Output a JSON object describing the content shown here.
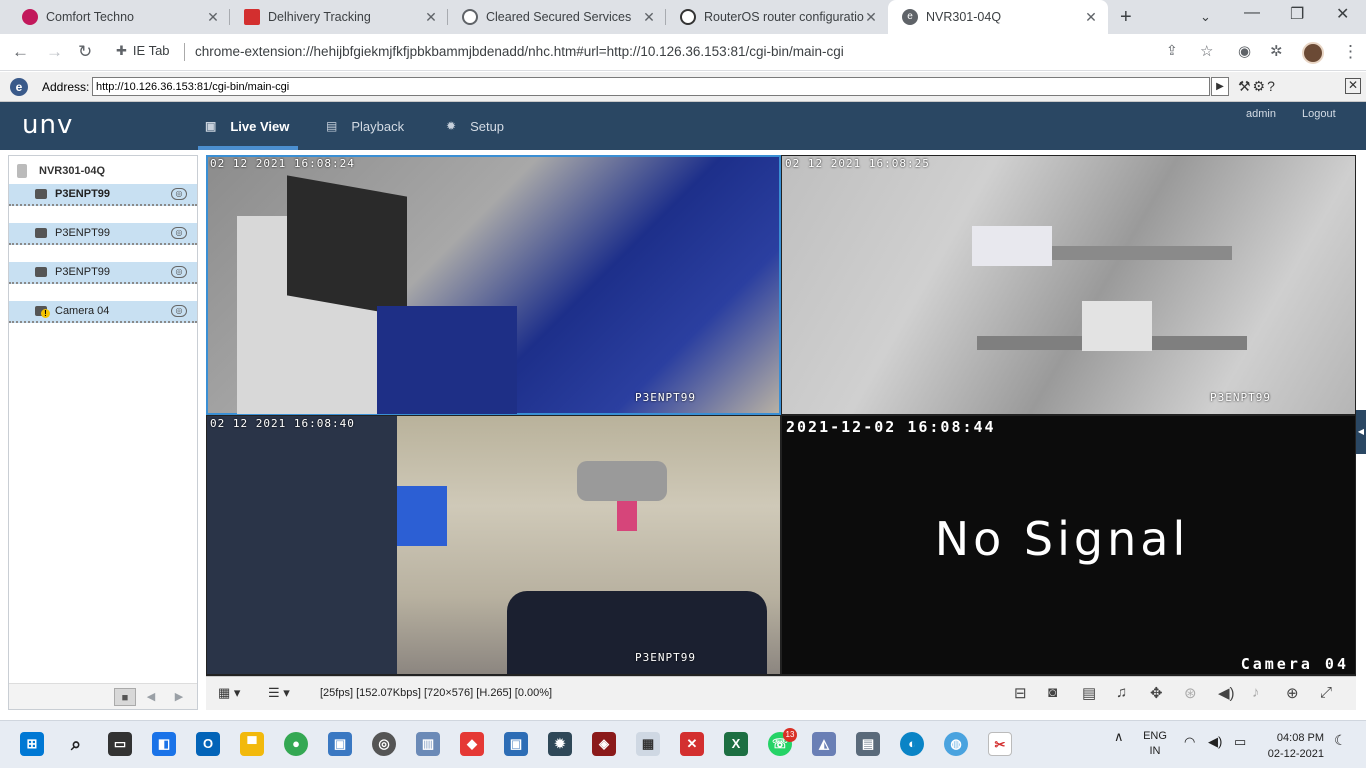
{
  "browser": {
    "tabs": [
      {
        "label": "Comfort Techno",
        "favicon": "#c2185b",
        "active": false
      },
      {
        "label": "Delhivery Tracking",
        "favicon": "#d32f2f",
        "active": false
      },
      {
        "label": "Cleared Secured Services",
        "favicon": "#5f6368",
        "active": false
      },
      {
        "label": "RouterOS router configuratio",
        "favicon": "#333333",
        "active": false
      },
      {
        "label": "NVR301-04Q",
        "favicon": "#5f6368",
        "active": true
      }
    ],
    "new_tab": "+",
    "extension_label": "IE Tab",
    "url": "chrome-extension://hehijbfgiekmjfkfjpbkbammjbdenadd/nhc.htm#url=http://10.126.36.153:81/cgi-bin/main-cgi"
  },
  "iebar": {
    "address_label": "Address:",
    "address_value": "http://10.126.36.153:81/cgi-bin/main-cgi"
  },
  "nvr": {
    "logo": "unv",
    "nav": [
      {
        "label": "Live View",
        "icon": "monitor-icon"
      },
      {
        "label": "Playback",
        "icon": "film-icon"
      },
      {
        "label": "Setup",
        "icon": "gear-icon"
      }
    ],
    "user": "admin",
    "logout": "Logout"
  },
  "device_tree": {
    "root": "NVR301-04Q",
    "cameras": [
      {
        "label": "P3ENPT99",
        "selected": true,
        "warning": false
      },
      {
        "label": "P3ENPT99",
        "selected": false,
        "warning": false
      },
      {
        "label": "P3ENPT99",
        "selected": false,
        "warning": false
      },
      {
        "label": "Camera 04",
        "selected": false,
        "warning": true
      }
    ]
  },
  "tiles": [
    {
      "time": "02 12 2021  16:08:24",
      "name": "P3ENPT99"
    },
    {
      "time": "02 12 2021  16:08:25",
      "name": "P3ENPT99"
    },
    {
      "time": "02 12 2021  16:08:40",
      "name": "P3ENPT99"
    },
    {
      "time": "2021-12-02 16:08:44",
      "name": "Camera 04",
      "message": "No  Signal"
    }
  ],
  "controlbar": {
    "stream_info": "[25fps] [152.07Kbps] [720×576] [H.265] [0.00%]"
  },
  "taskbar": {
    "lang_top": "ENG",
    "lang_bottom": "IN",
    "time": "04:08 PM",
    "date": "02-12-2021",
    "whatsapp_badge": "13"
  }
}
